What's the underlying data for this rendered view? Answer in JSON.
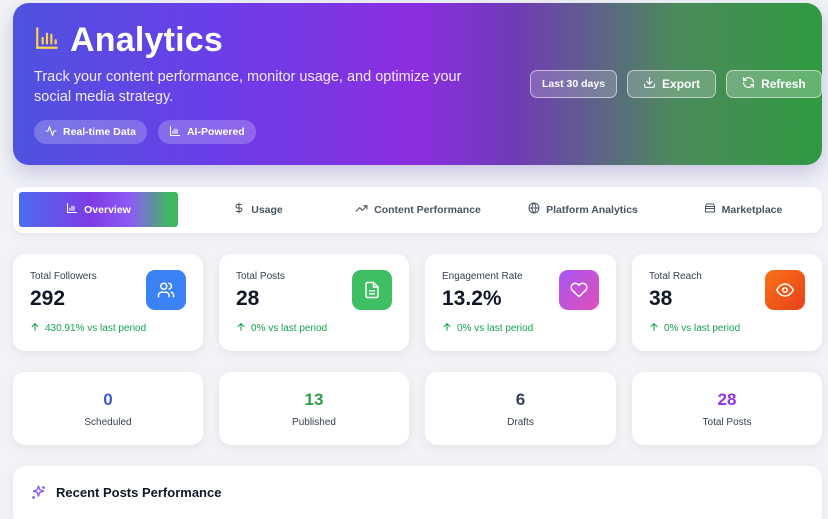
{
  "header": {
    "title": "Analytics",
    "description": "Track your content performance, monitor usage, and optimize your social media strategy.",
    "badges": [
      {
        "label": "Real-time Data",
        "icon": "activity-icon"
      },
      {
        "label": "AI-Powered",
        "icon": "bar-chart-icon"
      }
    ],
    "period": "Last 30 days",
    "export_label": "Export",
    "refresh_label": "Refresh",
    "colors": {
      "gradient_start": "#4f52e0",
      "gradient_mid": "#8b2ee0",
      "gradient_end": "#2f9a3f"
    }
  },
  "tabs": [
    {
      "label": "Overview",
      "icon": "bar-chart-icon",
      "active": true
    },
    {
      "label": "Usage",
      "icon": "dollar-icon",
      "active": false
    },
    {
      "label": "Content Performance",
      "icon": "trending-up-icon",
      "active": false
    },
    {
      "label": "Platform Analytics",
      "icon": "globe-icon",
      "active": false
    },
    {
      "label": "Marketplace",
      "icon": "store-icon",
      "active": false
    }
  ],
  "stats": [
    {
      "label": "Total Followers",
      "value": "292",
      "change": "430.91% vs last period",
      "icon": "users-icon",
      "color": "#3b82f6"
    },
    {
      "label": "Total Posts",
      "value": "28",
      "change": "0% vs last period",
      "icon": "document-icon",
      "color": "#22c55e"
    },
    {
      "label": "Engagement Rate",
      "value": "13.2%",
      "change": "0% vs last period",
      "icon": "heart-icon",
      "color": "#c04fe0"
    },
    {
      "label": "Total Reach",
      "value": "38",
      "change": "0% vs last period",
      "icon": "eye-icon",
      "color": "#f0541a"
    }
  ],
  "post_counts": [
    {
      "value": "0",
      "label": "Scheduled",
      "color": "#3b5bdb"
    },
    {
      "value": "13",
      "label": "Published",
      "color": "#2f9e44"
    },
    {
      "value": "6",
      "label": "Drafts",
      "color": "#374151"
    },
    {
      "value": "28",
      "label": "Total Posts",
      "color": "#9333ea"
    }
  ],
  "recent": {
    "title": "Recent Posts Performance",
    "icon": "sparkles-icon"
  }
}
